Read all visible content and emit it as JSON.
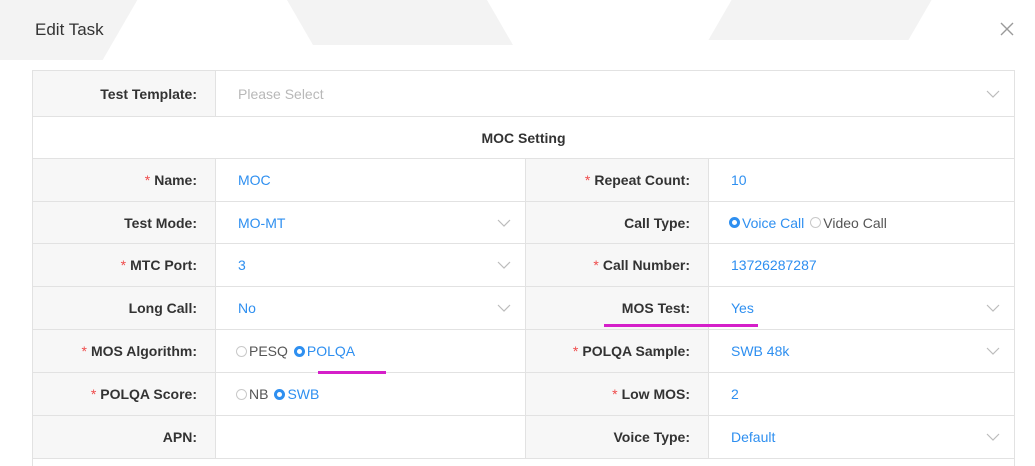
{
  "dialog": {
    "title": "Edit Task"
  },
  "test_template": {
    "label": "Test Template:",
    "placeholder": "Please Select"
  },
  "section": {
    "title": "MOC Setting"
  },
  "fields": {
    "name": {
      "label": "Name:",
      "value": "MOC",
      "required": "*"
    },
    "repeat_count": {
      "label": "Repeat Count:",
      "value": "10",
      "required": "*"
    },
    "test_mode": {
      "label": "Test Mode:",
      "value": "MO-MT"
    },
    "call_type": {
      "label": "Call Type:",
      "options": [
        "Voice Call",
        "Video Call"
      ],
      "selected": "Voice Call"
    },
    "mtc_port": {
      "label": "MTC Port:",
      "value": "3",
      "required": "*"
    },
    "call_number": {
      "label": "Call Number:",
      "value": "13726287287",
      "required": "*"
    },
    "long_call": {
      "label": "Long Call:",
      "value": "No"
    },
    "mos_test": {
      "label": "MOS Test:",
      "value": "Yes"
    },
    "mos_algorithm": {
      "label": "MOS Algorithm:",
      "options": [
        "PESQ",
        "POLQA"
      ],
      "selected": "POLQA",
      "required": "*"
    },
    "polqa_sample": {
      "label": "POLQA Sample:",
      "value": "SWB 48k",
      "required": "*"
    },
    "polqa_score": {
      "label": "POLQA Score:",
      "options": [
        "NB",
        "SWB"
      ],
      "selected": "SWB",
      "required": "*"
    },
    "low_mos": {
      "label": "Low MOS:",
      "value": "2",
      "required": "*"
    },
    "apn": {
      "label": "APN:",
      "value": ""
    },
    "voice_type": {
      "label": "Voice Type:",
      "value": "Default"
    }
  },
  "colors": {
    "accent": "#2e8ff0",
    "required": "#ef4b4b",
    "highlight": "#d51fc9"
  },
  "icons": {
    "close": "close-icon",
    "dropdown": "chevron-down-icon"
  }
}
